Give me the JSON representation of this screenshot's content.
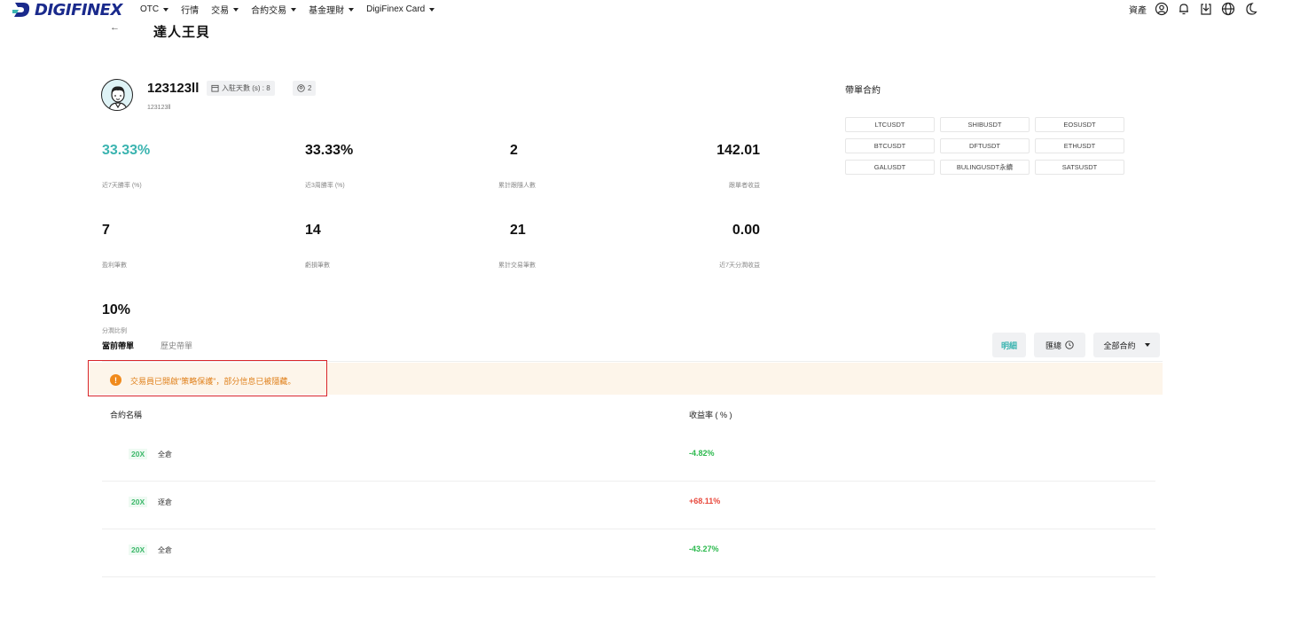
{
  "nav": {
    "logo_text": "DIGIFINEX",
    "items": [
      {
        "label": "OTC",
        "has_caret": true
      },
      {
        "label": "行情",
        "has_caret": false
      },
      {
        "label": "交易",
        "has_caret": true
      },
      {
        "label": "合約交易",
        "has_caret": true
      },
      {
        "label": "基金理財",
        "has_caret": true
      },
      {
        "label": "DigiFinex Card",
        "has_caret": true
      }
    ],
    "assets_label": "資產",
    "icons": [
      "user-icon",
      "bell-icon",
      "download-icon",
      "globe-icon",
      "moon-icon"
    ]
  },
  "header": {
    "back_arrow": "←",
    "title": "達人王貝"
  },
  "profile": {
    "username": "123123ll",
    "user_id": "123123ll",
    "days_label": "入駐天數 (s) : 8",
    "followers_count": "2"
  },
  "stats": [
    {
      "value": "33.33%",
      "label": "近7天勝率 (%)"
    },
    {
      "value": "33.33%",
      "label": "近3周勝率 (%)"
    },
    {
      "value": "2",
      "label": "累計跟隨人數"
    },
    {
      "value": "142.01",
      "label": "跟單者收益"
    },
    {
      "value": "7",
      "label": "盈利筆數"
    },
    {
      "value": "14",
      "label": "虧損筆數"
    },
    {
      "value": "21",
      "label": "累計交易筆數"
    },
    {
      "value": "0.00",
      "label": "近7天分潤收益"
    },
    {
      "value": "10%",
      "label": "分潤比例"
    }
  ],
  "contracts": {
    "title": "帶單合約",
    "items": [
      "LTCUSDT",
      "SHIBUSDT",
      "EOSUSDT",
      "BTCUSDT",
      "DFTUSDT",
      "ETHUSDT",
      "GALUSDT",
      "BULINGUSDT永續",
      "SATSUSDT"
    ]
  },
  "tabs": {
    "current": "當前帶單",
    "history": "歷史帶單"
  },
  "buttons": {
    "detail": "明細",
    "summary": "匯總",
    "all_contracts": "全部合約"
  },
  "notice": {
    "icon": "!",
    "text": "交易員已開啟\"策略保護\"，部分信息已被隱藏。"
  },
  "table": {
    "headers": {
      "name": "合約名稱",
      "yield": "收益率 ( % )"
    },
    "rows": [
      {
        "leverage": "20X",
        "mode": "全倉",
        "yield": "-4.82%",
        "sign": "neg"
      },
      {
        "leverage": "20X",
        "mode": "逐倉",
        "yield": "+68.11%",
        "sign": "pos"
      },
      {
        "leverage": "20X",
        "mode": "全倉",
        "yield": "-43.27%",
        "sign": "neg"
      }
    ]
  },
  "colors": {
    "accent_teal": "#3bb4b0",
    "negative_green": "#2bb94d",
    "positive_red": "#e8483c",
    "notice_orange": "#e0811c",
    "highlight_red": "#d9262b"
  }
}
